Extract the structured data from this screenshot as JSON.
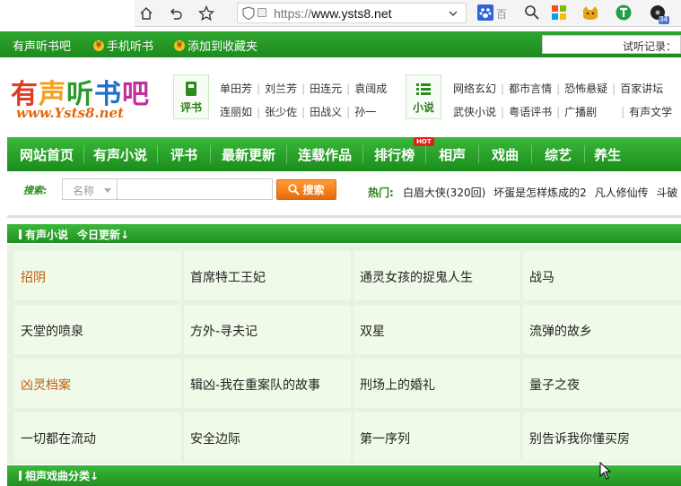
{
  "browser": {
    "url_scheme": "https://",
    "url_host": "www.ysts8.net",
    "search_text": "百",
    "ext_badge": "34"
  },
  "topbar": {
    "site_name": "有声听书吧",
    "mobile_link": "手机听书",
    "favorite_link": "添加到收藏夹",
    "history_label": "试听记录："
  },
  "header": {
    "logo_chars": [
      "有",
      "声",
      "听",
      "书",
      "吧"
    ],
    "logo_url": "www.Ysts8.net",
    "cat1": {
      "label": "评书",
      "links_row1": [
        "单田芳",
        "刘兰芳",
        "田连元",
        "袁阔成"
      ],
      "links_row2": [
        "连丽如",
        "张少佐",
        "田战义",
        "孙一"
      ]
    },
    "cat2": {
      "label": "小说",
      "links_row1": [
        "网络玄幻",
        "都市言情",
        "恐怖悬疑",
        "百家讲坛"
      ],
      "links_row2": [
        "武侠小说",
        "粤语评书",
        "广播剧",
        "有声文学"
      ]
    }
  },
  "nav": {
    "items": [
      "网站首页",
      "有声小说",
      "评书",
      "最新更新",
      "连载作品",
      "排行榜",
      "相声",
      "戏曲",
      "综艺",
      "养生"
    ],
    "hot_badge": "HOT"
  },
  "search": {
    "label": "搜索:",
    "select_value": "名称",
    "button_label": "搜索",
    "hot_label": "热门:",
    "hot_items": [
      "白眉大侠(320回)",
      "坏蛋是怎样炼成的2",
      "凡人修仙传",
      "斗破"
    ]
  },
  "section1": {
    "title": "有声小说",
    "subtitle": "今日更新↓",
    "rows": [
      [
        "招阴",
        "首席特工王妃",
        "通灵女孩的捉鬼人生",
        "战马"
      ],
      [
        "天堂的喷泉",
        "方外-寻夫记",
        "双星",
        "流弹的故乡"
      ],
      [
        "凶灵档案",
        "辑凶-我在重案队的故事",
        "刑场上的婚礼",
        "量子之夜"
      ],
      [
        "一切都在流动",
        "安全边际",
        "第一序列",
        "别告诉我你懂买房"
      ]
    ]
  },
  "section2": {
    "title": "相声戏曲分类↓"
  },
  "colors": {
    "green": "#1e8b1e",
    "orange": "#e86a0a",
    "cell_bg": "#effbe8"
  }
}
